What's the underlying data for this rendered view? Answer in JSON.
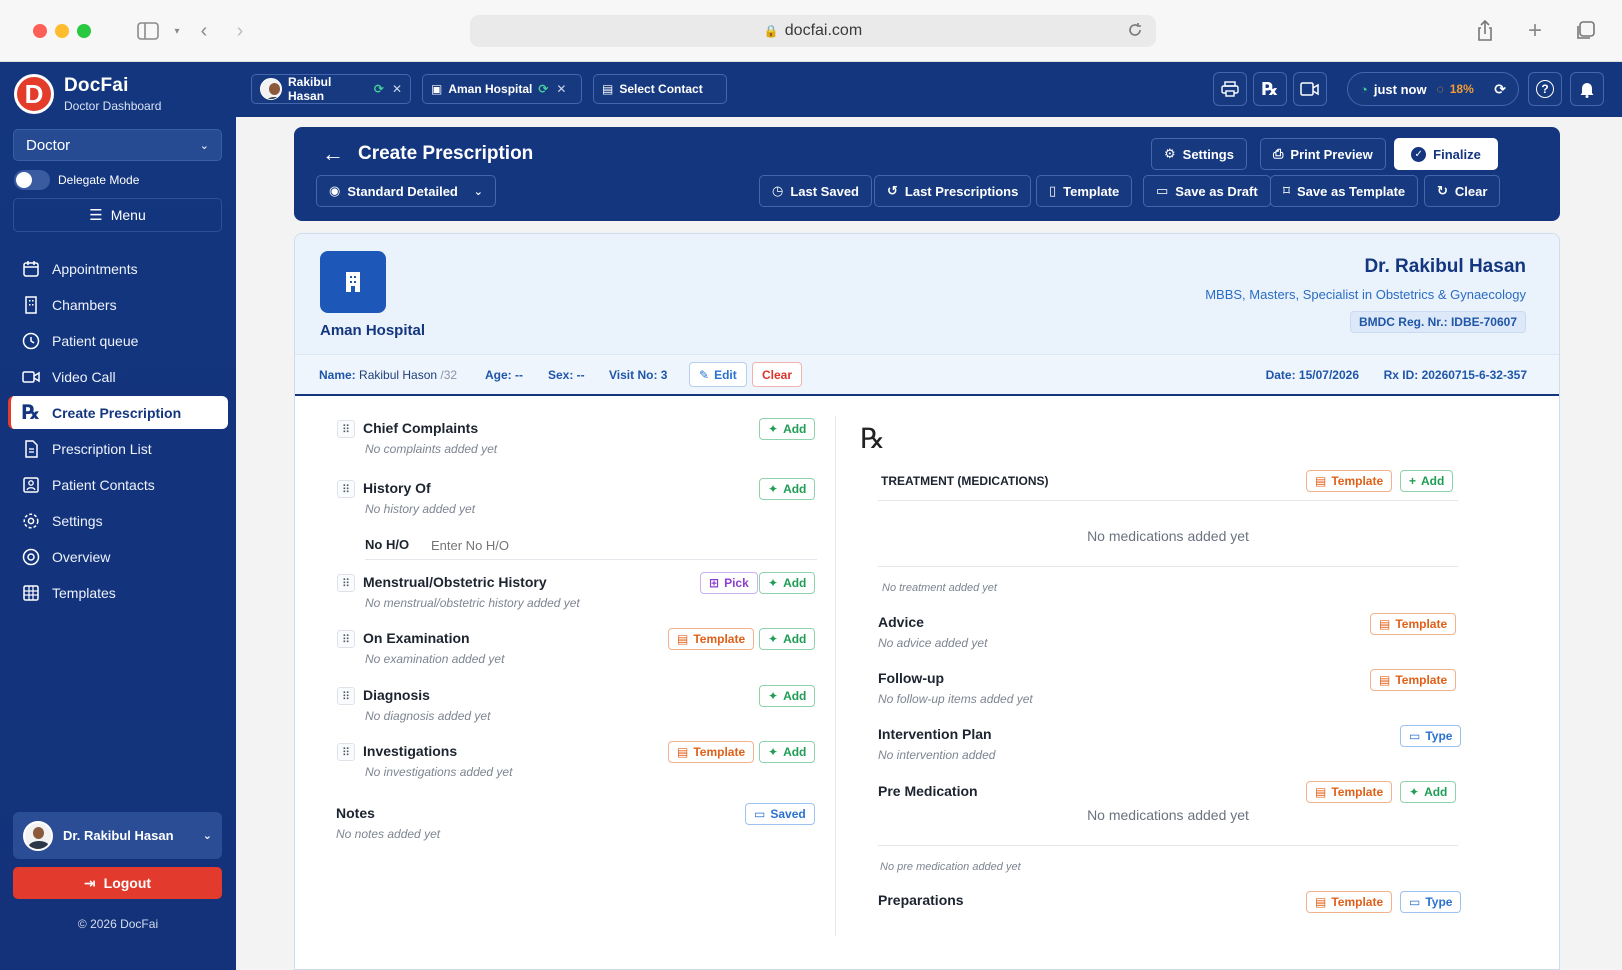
{
  "browser": {
    "url": "docfai.com"
  },
  "sidebar": {
    "brand_name": "DocFai",
    "brand_sub": "Doctor Dashboard",
    "role": "Doctor",
    "delegate_label": "Delegate Mode",
    "menu_label": "Menu",
    "items": [
      {
        "label": "Appointments",
        "icon": "calendar-icon"
      },
      {
        "label": "Chambers",
        "icon": "building-icon"
      },
      {
        "label": "Patient queue",
        "icon": "clock-icon"
      },
      {
        "label": "Video Call",
        "icon": "video-icon"
      },
      {
        "label": "Create Prescription",
        "icon": "rx-icon"
      },
      {
        "label": "Prescription List",
        "icon": "document-icon"
      },
      {
        "label": "Patient Contacts",
        "icon": "contacts-icon"
      },
      {
        "label": "Settings",
        "icon": "gear-icon"
      },
      {
        "label": "Overview",
        "icon": "target-icon"
      },
      {
        "label": "Templates",
        "icon": "grid-icon"
      }
    ],
    "active_item": "Create Prescription",
    "user_name": "Dr. Rakibul Hasan",
    "logout_label": "Logout",
    "copyright": "© 2026 DocFai"
  },
  "appbar": {
    "chip_doctor": "Rakibul Hasan",
    "chip_hospital": "Aman Hospital",
    "chip_contact": "Select Contact",
    "status_text": "just now",
    "status_percent": "18%"
  },
  "header": {
    "title": "Create Prescription",
    "view_mode": "Standard Detailed",
    "settings_label": "Settings",
    "print_label": "Print Preview",
    "finalize_label": "Finalize",
    "last_saved_label": "Last Saved",
    "last_rx_label": "Last Prescriptions",
    "template_label": "Template",
    "draft_label": "Save as Draft",
    "save_tpl_label": "Save as Template",
    "clear_label": "Clear"
  },
  "prescription": {
    "hospital_name": "Aman Hospital",
    "doctor_name": "Dr. Rakibul Hasan",
    "doctor_quals": "MBBS, Masters, Specialist in Obstetrics & Gynaecology",
    "doctor_reg": "BMDC Reg. Nr.: IDBE-70607",
    "patient_name_label": "Name:",
    "patient_name": "Rakibul Hason",
    "patient_id": "/32",
    "age": "Age: --",
    "sex": "Sex: --",
    "visit": "Visit No: 3",
    "edit_label": "Edit",
    "clear_label": "Clear",
    "date": "Date: 15/07/2026",
    "rx_id": "Rx ID: 20260715-6-32-357"
  },
  "left_sections": {
    "chief": {
      "title": "Chief Complaints",
      "empty": "No complaints added yet"
    },
    "history": {
      "title": "History Of",
      "empty": "No history added yet"
    },
    "noho_label": "No H/O",
    "noho_placeholder": "Enter No H/O",
    "menstrual": {
      "title": "Menstrual/Obstetric History",
      "empty": "No menstrual/obstetric history added yet"
    },
    "exam": {
      "title": "On Examination",
      "empty": "No examination added yet"
    },
    "diagnosis": {
      "title": "Diagnosis",
      "empty": "No diagnosis added yet"
    },
    "invest": {
      "title": "Investigations",
      "empty": "No investigations added yet"
    },
    "notes": {
      "title": "Notes",
      "empty": "No notes added yet"
    }
  },
  "right_sections": {
    "rx_symbol": "℞",
    "treatment_title": "TREATMENT (MEDICATIONS)",
    "no_meds": "No medications added yet",
    "no_treatment": "No treatment added yet",
    "advice": {
      "title": "Advice",
      "empty": "No advice added yet"
    },
    "followup": {
      "title": "Follow-up",
      "empty": "No follow-up items added yet"
    },
    "intervention": {
      "title": "Intervention Plan",
      "empty": "No intervention added"
    },
    "premed": {
      "title": "Pre Medication",
      "no_meds": "No medications added yet",
      "empty": "No pre medication added yet"
    },
    "preparations": {
      "title": "Preparations"
    }
  },
  "buttons": {
    "add": "Add",
    "template": "Template",
    "pick": "Pick",
    "type": "Type",
    "saved": "Saved"
  },
  "colors": {
    "primary": "#13367f",
    "accent_red": "#e43c2b",
    "add_green": "#1f9d55",
    "template_orange": "#e0601a"
  }
}
